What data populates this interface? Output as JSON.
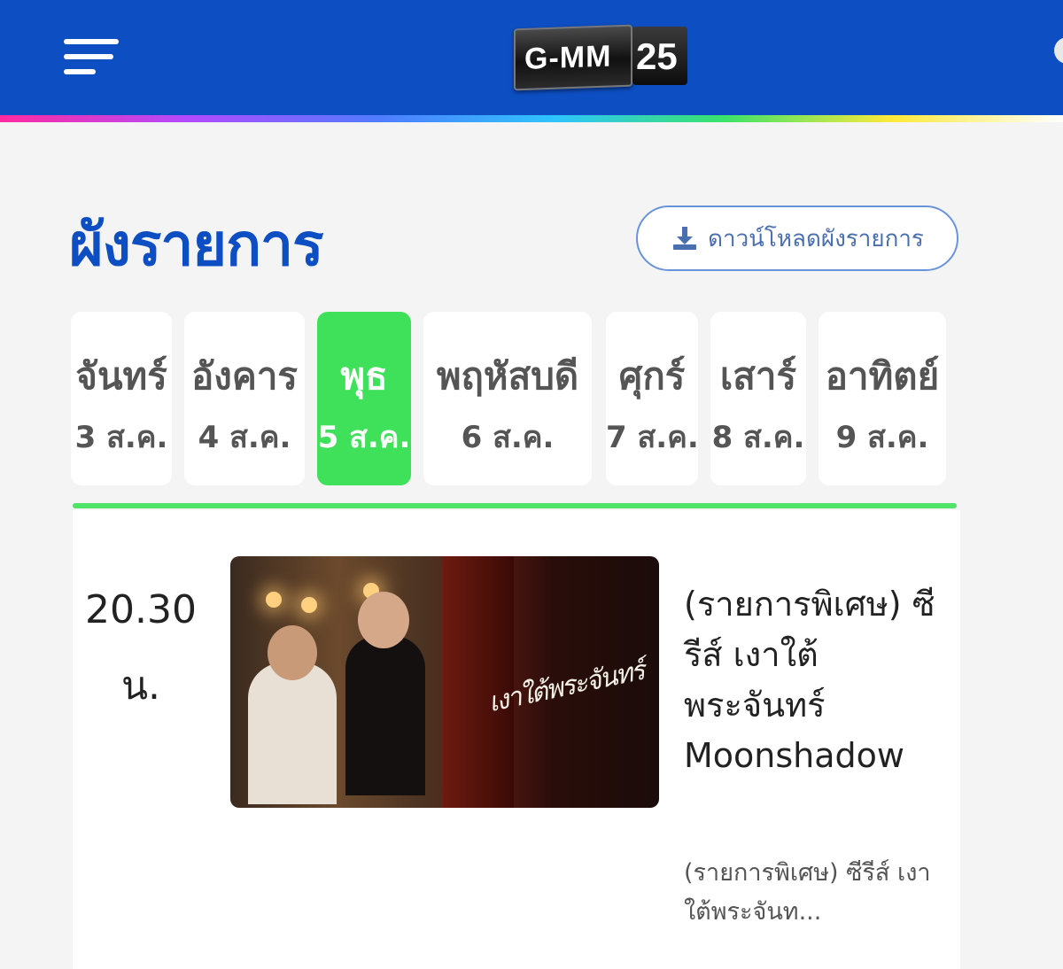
{
  "header": {
    "menu_icon": "hamburger-menu-icon",
    "logo_text": "G-MM",
    "logo_number": "25",
    "brand_color": "#0d4ec2"
  },
  "schedule": {
    "title": "ผังรายการ",
    "download_label": "ดาวน์โหลดผังรายการ",
    "download_icon": "download-icon",
    "accent_color": "#3fe05a",
    "days": [
      {
        "name": "จันทร์",
        "date": "3 ส.ค."
      },
      {
        "name": "อังคาร",
        "date": "4 ส.ค."
      },
      {
        "name": "พุธ",
        "date": "5 ส.ค.",
        "active": true
      },
      {
        "name": "พฤหัสบดี",
        "date": "6 ส.ค."
      },
      {
        "name": "ศุกร์",
        "date": "7 ส.ค."
      },
      {
        "name": "เสาร์",
        "date": "8 ส.ค."
      },
      {
        "name": "อาทิตย์",
        "date": "9 ส.ค."
      }
    ],
    "program": {
      "time": "20.30 น.",
      "title": "(รายการพิเศษ) ซีรีส์ เงาใต้พระจันทร์ Moonshadow",
      "description": "(รายการพิเศษ) ซีรีส์ เงาใต้พระจันท...",
      "thumb_script": "เงาใต้พระจันทร์"
    }
  }
}
